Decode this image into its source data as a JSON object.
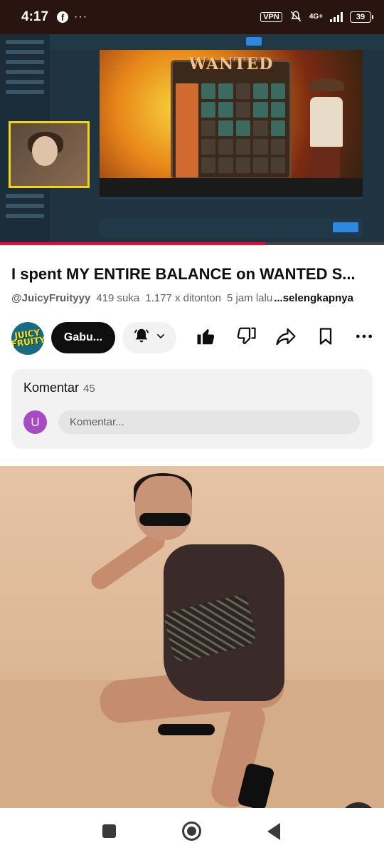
{
  "status_bar": {
    "time": "4:17",
    "facebook_icon": "f",
    "more_dots": "···",
    "vpn": "VPN",
    "network": "4G+",
    "battery": "39"
  },
  "video": {
    "game_title": "WANTED",
    "progress_fraction": 0.69
  },
  "video_details": {
    "title": "I spent MY ENTIRE BALANCE on WANTED S...",
    "channel": "@JuicyFruityyy",
    "likes": "419 suka",
    "views": "1.177 x ditonton",
    "age": "5 jam lalu",
    "more": "...selengkapnya"
  },
  "actions": {
    "channel_logo": "JUICY FRUITY",
    "join_label": "Gabu...",
    "bell_icon": "bell-icon",
    "like_icon": "thumbs-up-icon",
    "dislike_icon": "thumbs-down-icon",
    "share_icon": "share-icon",
    "save_icon": "bookmark-icon",
    "more_icon": "more-icon"
  },
  "comments": {
    "label": "Komentar",
    "count": "45",
    "user_initial": "U",
    "placeholder": "Komentar..."
  },
  "colors": {
    "accent": "#ff0033",
    "avatar": "#a64bc4",
    "text_primary": "#0f0f0f",
    "text_secondary": "#606060"
  }
}
